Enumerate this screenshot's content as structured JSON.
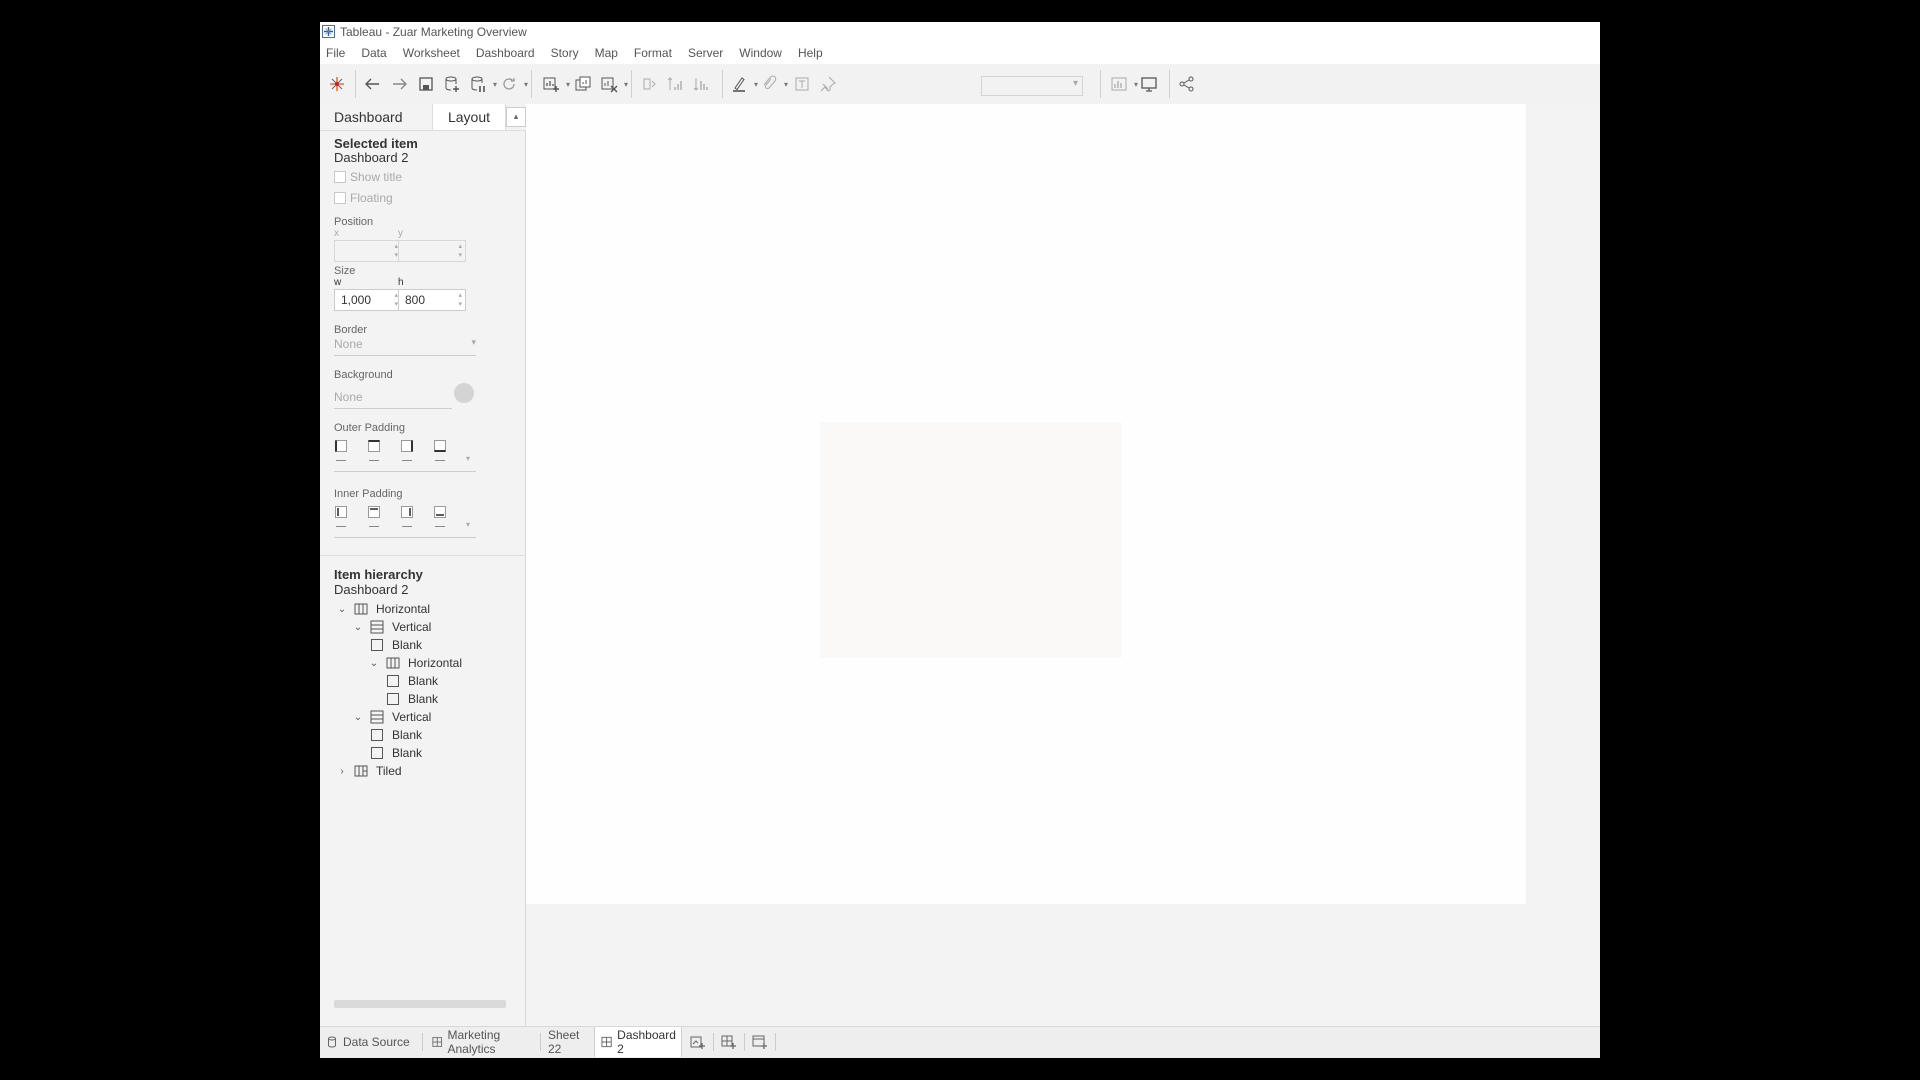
{
  "window": {
    "title": "Tableau - Zuar Marketing Overview"
  },
  "menu": [
    "File",
    "Data",
    "Worksheet",
    "Dashboard",
    "Story",
    "Map",
    "Format",
    "Server",
    "Window",
    "Help"
  ],
  "toolbar": {
    "icons": [
      "tableau-logo-icon",
      "undo-icon",
      "redo-icon",
      "save-icon",
      "new-data-source-icon",
      "pause-updates-icon",
      "refresh-icon",
      "new-worksheet-icon",
      "duplicate-sheet-icon",
      "clear-sheet-icon",
      "swap-axes-icon",
      "sort-ascending-icon",
      "sort-descending-icon",
      "highlight-icon",
      "group-icon",
      "show-labels-icon",
      "fix-axes-icon",
      "show-me-icon",
      "presentation-mode-icon",
      "share-icon"
    ],
    "fit_select_value": ""
  },
  "panel": {
    "tabs": {
      "dashboard": "Dashboard",
      "layout": "Layout"
    },
    "selected_item": {
      "heading": "Selected item",
      "value": "Dashboard 2"
    },
    "show_title": {
      "label": "Show title",
      "checked": false
    },
    "floating": {
      "label": "Floating",
      "checked": false
    },
    "position": {
      "label": "Position",
      "x_label": "x",
      "y_label": "y",
      "x_value": "",
      "y_value": ""
    },
    "size": {
      "label": "Size",
      "w_label": "w",
      "h_label": "h",
      "w_value": "1,000",
      "h_value": "800"
    },
    "border": {
      "label": "Border",
      "value": "None"
    },
    "background": {
      "label": "Background",
      "value": "None",
      "swatch_color": "#d4d4d4"
    },
    "outer_padding": {
      "label": "Outer Padding",
      "values": [
        "",
        "",
        "",
        ""
      ]
    },
    "inner_padding": {
      "label": "Inner Padding",
      "values": [
        "",
        "",
        "",
        ""
      ]
    },
    "hierarchy": {
      "heading": "Item hierarchy",
      "root": "Dashboard 2",
      "items": [
        {
          "label": "Horizontal",
          "type": "horizontal",
          "expanded": true
        },
        {
          "label": "Vertical",
          "type": "vertical",
          "expanded": true
        },
        {
          "label": "Blank",
          "type": "blank"
        },
        {
          "label": "Horizontal",
          "type": "horizontal",
          "expanded": true
        },
        {
          "label": "Blank",
          "type": "blank"
        },
        {
          "label": "Blank",
          "type": "blank"
        },
        {
          "label": "Vertical",
          "type": "vertical",
          "expanded": true
        },
        {
          "label": "Blank",
          "type": "blank"
        },
        {
          "label": "Blank",
          "type": "blank"
        },
        {
          "label": "Tiled",
          "type": "tiled",
          "expanded": false
        }
      ]
    }
  },
  "sheet_tabs": [
    {
      "label": "Data Source",
      "icon": "data-source-icon",
      "active": false
    },
    {
      "label": "Marketing Analytics",
      "icon": "dashboard-icon",
      "active": false
    },
    {
      "label": "Sheet 22",
      "icon": "",
      "active": false
    },
    {
      "label": "Dashboard 2",
      "icon": "dashboard-icon",
      "active": true
    }
  ],
  "colors": {
    "accent": "#1f4e79",
    "canvas_blank": "#fbf8f8"
  }
}
